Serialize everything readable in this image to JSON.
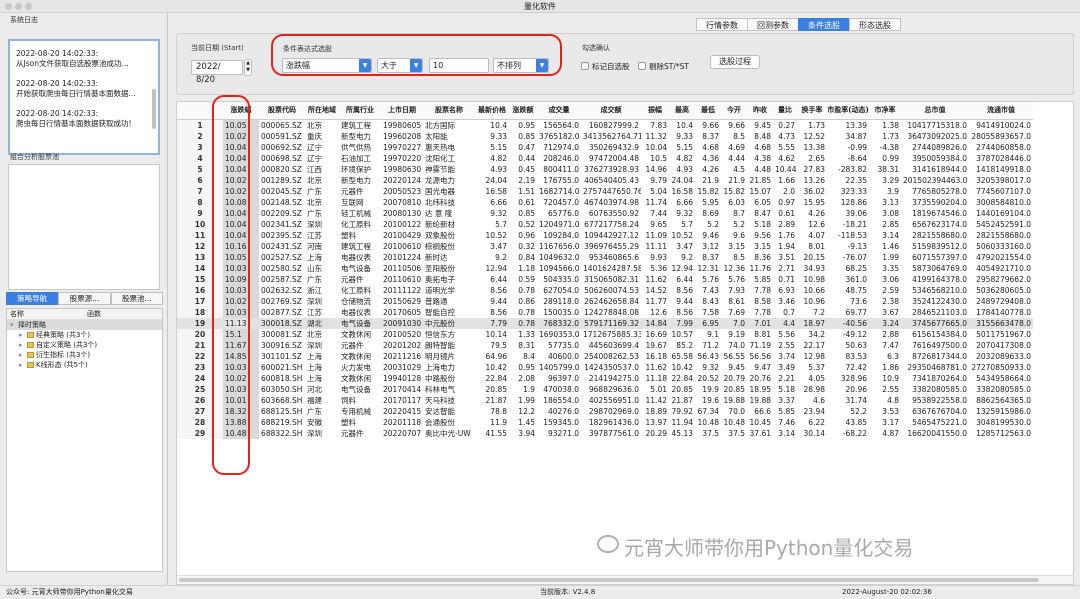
{
  "window": {
    "title": "量化软件"
  },
  "sidebar": {
    "log_label": "系统日志",
    "log_entries": [
      {
        "time": "2022-08-20 14:02:33:",
        "msg": "从Json文件获取自选股票池成功..."
      },
      {
        "time": "2022-08-20 14:02:33:",
        "msg": "开始获取爬虫每日行情基本面数据..."
      },
      {
        "time": "2022-08-20 14:02:33:",
        "msg": "爬虫每日行情基本面数据获取成功!"
      }
    ],
    "pool_label": "组合分析股票池",
    "nav_tabs": [
      "策略导航",
      "股票源...",
      "股票池..."
    ],
    "tree_header": {
      "name": "名称",
      "func": "函数"
    },
    "tree_root": "择时策略",
    "tree_items": [
      "经典策略 (共3个)",
      "自定义策略 (共3个)",
      "衍生指标 (共3个)",
      "K线形态 (共5个)"
    ]
  },
  "tabs": [
    "行情参数",
    "回测参数",
    "条件选股",
    "形态选股"
  ],
  "form": {
    "date_label": "当前日期 (Start)",
    "date_value": "2022/ 8/20",
    "cond_label": "条件表达式选股",
    "field": "涨跌幅",
    "op": "大于",
    "value": "10",
    "sort": "不排列",
    "check_label": "勾选确认",
    "chk_mark": "标记自选股",
    "chk_remove": "剔除ST/*ST",
    "btn_select": "选股过程"
  },
  "table": {
    "columns": [
      "涨跌幅",
      "股票代码",
      "所在地域",
      "所属行业",
      "上市日期",
      "股票名称",
      "最新价格",
      "涨跌额",
      "成交量",
      "成交额",
      "振幅",
      "最高",
      "最低",
      "今开",
      "昨收",
      "量比",
      "换手率",
      "市盈率(动态)",
      "市净率",
      "总市值",
      "流通市值"
    ],
    "rows": [
      [
        "10.05",
        "000065.SZ",
        "北京",
        "建筑工程",
        "19980605",
        "北方国际",
        "10.4",
        "0.95",
        "156564.0",
        "160827999.2",
        "7.83",
        "10.4",
        "9.66",
        "9.66",
        "9.45",
        "0.27",
        "1.73",
        "13.39",
        "1.38",
        "10417715318.0",
        "9414910024.0"
      ],
      [
        "10.02",
        "000591.SZ",
        "重庆",
        "新型电力",
        "19960208",
        "太阳能",
        "9.33",
        "0.85",
        "3765182.0",
        "3413562764.71",
        "11.32",
        "9.33",
        "8.37",
        "8.5",
        "8.48",
        "4.73",
        "12.52",
        "34.87",
        "1.73",
        "36473092025.0",
        "28055893657.0"
      ],
      [
        "10.04",
        "000692.SZ",
        "辽宁",
        "供气供热",
        "19970227",
        "惠天热电",
        "5.15",
        "0.47",
        "712974.0",
        "350269432.9",
        "10.04",
        "5.15",
        "4.68",
        "4.69",
        "4.68",
        "5.55",
        "13.38",
        "-0.99",
        "-4.38",
        "2744089826.0",
        "2744060858.0"
      ],
      [
        "10.04",
        "000698.SZ",
        "辽宁",
        "石油加工",
        "19970220",
        "沈阳化工",
        "4.82",
        "0.44",
        "208246.0",
        "97472004.48",
        "10.5",
        "4.82",
        "4.36",
        "4.44",
        "4.38",
        "4.62",
        "2.65",
        "-8.64",
        "0.99",
        "3950059384.0",
        "3787028446.0"
      ],
      [
        "10.04",
        "000820.SZ",
        "江西",
        "环境保护",
        "19980630",
        "神雾节能",
        "4.93",
        "0.45",
        "800411.0",
        "376273928.93",
        "14.96",
        "4.93",
        "4.26",
        "4.5",
        "4.48",
        "10.44",
        "27.83",
        "-283.82",
        "38.31",
        "3141618944.0",
        "1418149918.0"
      ],
      [
        "10.02",
        "001289.SZ",
        "北京",
        "新型电力",
        "20220124",
        "龙源电力",
        "24.04",
        "2.19",
        "176755.0",
        "406540405.43",
        "9.79",
        "24.04",
        "21.9",
        "21.9",
        "21.85",
        "1.66",
        "13.26",
        "22.35",
        "3.29",
        "201502394463.0",
        "3205398017.0"
      ],
      [
        "10.02",
        "002045.SZ",
        "广东",
        "元器件",
        "20050523",
        "国光电器",
        "16.58",
        "1.51",
        "1682714.0",
        "2757447650.76",
        "5.04",
        "16.58",
        "15.82",
        "15.82",
        "15.07",
        "2.0",
        "36.02",
        "323.33",
        "3.9",
        "7765805278.0",
        "7745607107.0"
      ],
      [
        "10.08",
        "002148.SZ",
        "北京",
        "互联网",
        "20070810",
        "北纬科技",
        "6.66",
        "0.61",
        "720457.0",
        "467403974.98",
        "11.74",
        "6.66",
        "5.95",
        "6.03",
        "6.05",
        "0.97",
        "15.95",
        "128.86",
        "3.13",
        "3735590204.0",
        "3008584810.0"
      ],
      [
        "10.04",
        "002209.SZ",
        "广东",
        "轻工机械",
        "20080130",
        "达 意 隆",
        "9.32",
        "0.85",
        "65776.0",
        "60763550.92",
        "7.44",
        "9.32",
        "8.69",
        "8.7",
        "8.47",
        "0.61",
        "4.26",
        "39.06",
        "3.08",
        "1819674546.0",
        "1440169104.0"
      ],
      [
        "10.04",
        "002341.SZ",
        "深圳",
        "化工原料",
        "20100122",
        "新纶新材",
        "5.7",
        "0.52",
        "1204971.0",
        "677217758.24",
        "9.65",
        "5.7",
        "5.2",
        "5.2",
        "5.18",
        "2.89",
        "12.6",
        "-18.21",
        "2.85",
        "6567623174.0",
        "5452452591.0"
      ],
      [
        "10.04",
        "002395.SZ",
        "江苏",
        "塑料",
        "20100429",
        "双象股份",
        "10.52",
        "0.96",
        "109284.0",
        "109442927.12",
        "11.09",
        "10.52",
        "9.46",
        "9.6",
        "9.56",
        "1.76",
        "4.07",
        "-118.53",
        "3.14",
        "2821558680.0",
        "2821558680.0"
      ],
      [
        "10.16",
        "002431.SZ",
        "河南",
        "建筑工程",
        "20100610",
        "棕榈股份",
        "3.47",
        "0.32",
        "1167656.0",
        "396976455.29",
        "11.11",
        "3.47",
        "3.12",
        "3.15",
        "3.15",
        "1.94",
        "8.01",
        "-9.13",
        "1.46",
        "5159839512.0",
        "5060333160.0"
      ],
      [
        "10.05",
        "002527.SZ",
        "上海",
        "电器仪表",
        "20101224",
        "新时达",
        "9.2",
        "0.84",
        "1049632.0",
        "953460865.6",
        "9.93",
        "9.2",
        "8.37",
        "8.5",
        "8.36",
        "3.51",
        "20.15",
        "-76.07",
        "1.99",
        "6071557397.0",
        "4792021554.0"
      ],
      [
        "10.03",
        "002580.SZ",
        "山东",
        "电气设备",
        "20110506",
        "圣阳股份",
        "12.94",
        "1.18",
        "1094566.0",
        "1401624287.58",
        "5.36",
        "12.94",
        "12.31",
        "12.36",
        "11.76",
        "2.71",
        "34.93",
        "68.25",
        "3.35",
        "5873064769.0",
        "4054921710.0"
      ],
      [
        "10.09",
        "002587.SZ",
        "广东",
        "元器件",
        "20110610",
        "奥拓电子",
        "6.44",
        "0.59",
        "504335.0",
        "315065082.31",
        "11.62",
        "6.44",
        "5.76",
        "5.76",
        "5.85",
        "0.71",
        "10.98",
        "361.0",
        "3.06",
        "4199164378.0",
        "2958279662.0"
      ],
      [
        "10.03",
        "002632.SZ",
        "浙江",
        "化工原料",
        "20111122",
        "道明光学",
        "8.56",
        "0.78",
        "627054.0",
        "506260074.53",
        "14.52",
        "8.56",
        "7.43",
        "7.93",
        "7.78",
        "6.93",
        "10.66",
        "48.75",
        "2.59",
        "5346568210.0",
        "5036280605.0"
      ],
      [
        "10.02",
        "002769.SZ",
        "深圳",
        "仓储物流",
        "20150629",
        "普路通",
        "9.44",
        "0.86",
        "289118.0",
        "262462658.84",
        "11.77",
        "9.44",
        "8.43",
        "8.61",
        "8.58",
        "3.46",
        "10.96",
        "73.6",
        "2.38",
        "3524122430.0",
        "2489729408.0"
      ],
      [
        "10.03",
        "002877.SZ",
        "江苏",
        "电器仪表",
        "20170605",
        "智能自控",
        "8.56",
        "0.78",
        "150035.0",
        "124278848.08",
        "12.6",
        "8.56",
        "7.58",
        "7.69",
        "7.78",
        "0.7",
        "7.2",
        "69.77",
        "3.67",
        "2846521103.0",
        "1784140778.0"
      ],
      [
        "11.13",
        "300018.SZ",
        "湖北",
        "电气设备",
        "20091030",
        "中元股份",
        "7.79",
        "0.78",
        "768332.0",
        "579171169.32",
        "14.84",
        "7.99",
        "6.95",
        "7.0",
        "7.01",
        "4.4",
        "18.97",
        "-40.56",
        "3.24",
        "3745677665.0",
        "3155663478.0"
      ],
      [
        "15.1",
        "300081.SZ",
        "北京",
        "文教休闲",
        "20100520",
        "恒信东方",
        "10.14",
        "1.33",
        "1690353.0",
        "1712675885.33",
        "16.69",
        "10.57",
        "9.1",
        "9.19",
        "8.81",
        "5.56",
        "34.2",
        "-49.12",
        "2.88",
        "6156154384.0",
        "5011751967.0"
      ],
      [
        "11.67",
        "300916.SZ",
        "深圳",
        "元器件",
        "20201202",
        "朗特智能",
        "79.5",
        "8.31",
        "57735.0",
        "445603699.4",
        "19.67",
        "85.2",
        "71.2",
        "74.0",
        "71.19",
        "2.55",
        "22.17",
        "50.63",
        "7.47",
        "7616497500.0",
        "2070417308.0"
      ],
      [
        "14.85",
        "301101.SZ",
        "上海",
        "文教休闲",
        "20211216",
        "明月镜片",
        "64.96",
        "8.4",
        "40600.0",
        "254008262.53",
        "16.18",
        "65.58",
        "56.43",
        "56.55",
        "56.56",
        "3.74",
        "12.98",
        "83.53",
        "6.3",
        "8726817344.0",
        "2032089633.0"
      ],
      [
        "10.03",
        "600021.SH",
        "上海",
        "火力发电",
        "20031029",
        "上海电力",
        "10.42",
        "0.95",
        "1405799.0",
        "1424350537.0",
        "11.62",
        "10.42",
        "9.32",
        "9.45",
        "9.47",
        "3.49",
        "5.37",
        "72.42",
        "1.86",
        "29350468781.0",
        "27270850933.0"
      ],
      [
        "10.02",
        "600818.SH",
        "上海",
        "文教休闲",
        "19940128",
        "中路股份",
        "22.84",
        "2.08",
        "96397.0",
        "214194275.0",
        "11.18",
        "22.84",
        "20.52",
        "20.79",
        "20.76",
        "2.21",
        "4.05",
        "328.96",
        "10.9",
        "7341870264.0",
        "5434958664.0"
      ],
      [
        "10.03",
        "603050.SH",
        "河北",
        "电气设备",
        "20170414",
        "科林电气",
        "20.85",
        "1.9",
        "470038.0",
        "968829636.0",
        "5.01",
        "20.85",
        "19.9",
        "20.85",
        "18.95",
        "5.18",
        "28.98",
        "20.96",
        "2.55",
        "3382080585.0",
        "3382080585.0"
      ],
      [
        "10.01",
        "603668.SH",
        "福建",
        "饲料",
        "20170117",
        "天马科技",
        "21.87",
        "1.99",
        "186554.0",
        "402556951.0",
        "11.42",
        "21.87",
        "19.6",
        "19.88",
        "19.88",
        "3.37",
        "4.6",
        "31.74",
        "4.8",
        "9538922558.0",
        "8862564365.0"
      ],
      [
        "18.32",
        "688125.SH",
        "广东",
        "专用机械",
        "20220415",
        "安达智能",
        "78.8",
        "12.2",
        "40276.0",
        "298702969.0",
        "18.89",
        "79.92",
        "67.34",
        "70.0",
        "66.6",
        "5.85",
        "23.94",
        "52.2",
        "3.53",
        "6367676704.0",
        "1325915986.0"
      ],
      [
        "13.88",
        "688219.SH",
        "安徽",
        "塑料",
        "20201118",
        "会通股份",
        "11.9",
        "1.45",
        "159345.0",
        "182961436.0",
        "13.97",
        "11.94",
        "10.48",
        "10.48",
        "10.45",
        "7.46",
        "6.22",
        "43.85",
        "3.17",
        "5465475221.0",
        "3048199530.0"
      ],
      [
        "10.48",
        "688322.SH",
        "深圳",
        "元器件",
        "20220707",
        "奥比中光-UW",
        "41.55",
        "3.94",
        "93271.0",
        "397877561.0",
        "20.29",
        "45.13",
        "37.5",
        "37.5",
        "37.61",
        "3.14",
        "30.14",
        "-68.22",
        "4.87",
        "16620041550.0",
        "1285712563.0"
      ]
    ]
  },
  "status": {
    "left": "公众号: 元宵大师带你用Python量化交易",
    "version": "当前版本: V2.4.8",
    "time": "2022-August-20 02:02:36"
  },
  "watermark": "元宵大师带你用Python量化交易",
  "colors": {
    "accent": "#3b7fe0",
    "highlight": "#e0231b"
  }
}
